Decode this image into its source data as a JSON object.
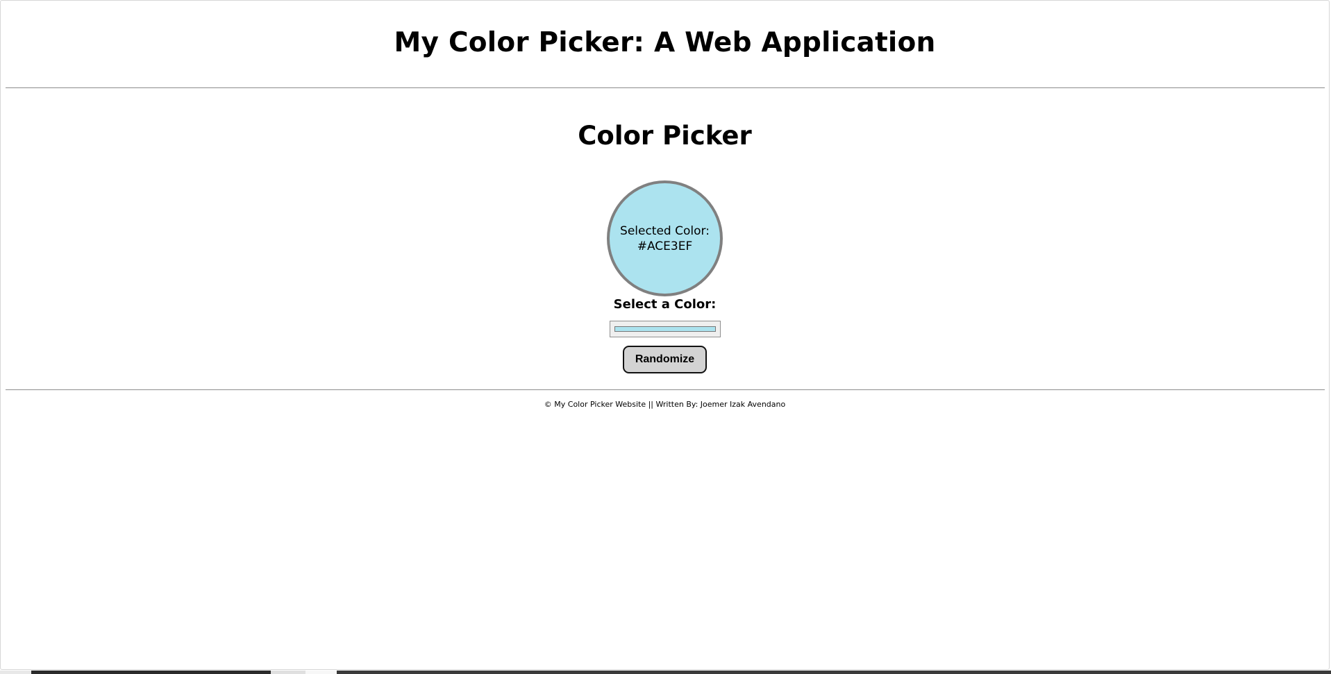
{
  "header": {
    "title": "My Color Picker: A Web Application"
  },
  "main": {
    "heading": "Color Picker",
    "swatch": {
      "label": "Selected Color:",
      "value": "#ACE3EF",
      "color": "#ACE3EF",
      "border_color": "#808080"
    },
    "picker_label": "Select a Color:",
    "input_value": "#ace3ef",
    "randomize_label": "Randomize"
  },
  "footer": {
    "text": "© My Color Picker Website || Written By: Joemer Izak Avendano"
  },
  "colors": {
    "background": "#ffffff",
    "rule": "#8c8c8c",
    "button_bg": "#d3d3d3"
  }
}
